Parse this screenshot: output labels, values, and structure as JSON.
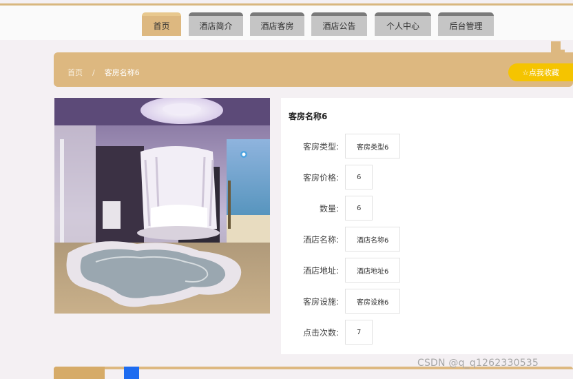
{
  "nav": {
    "items": [
      "首页",
      "酒店简介",
      "酒店客房",
      "酒店公告",
      "个人中心",
      "后台管理"
    ],
    "active_index": 0
  },
  "breadcrumb": {
    "home": "首页",
    "separator": "/",
    "current": "客房名称6"
  },
  "favorite_button": {
    "icon": "star-outline-icon",
    "label": "点我收藏",
    "star": "☆"
  },
  "room": {
    "title": "客房名称6",
    "fields": [
      {
        "label": "客房类型:",
        "value": "客房类型6"
      },
      {
        "label": "客房价格:",
        "value": "6"
      },
      {
        "label": "数量:",
        "value": "6"
      },
      {
        "label": "酒店名称:",
        "value": "酒店名称6"
      },
      {
        "label": "酒店地址:",
        "value": "酒店地址6"
      },
      {
        "label": "客房设施:",
        "value": "客房设施6"
      },
      {
        "label": "点击次数:",
        "value": "7"
      }
    ]
  },
  "watermark": "CSDN @q_q1262330535",
  "colors": {
    "accent": "#ddb880",
    "favorite": "#f5c400",
    "nav_inactive": "#c5c5c5"
  }
}
